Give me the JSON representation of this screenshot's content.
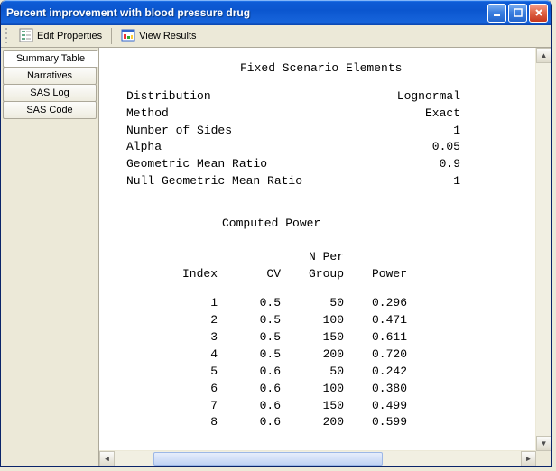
{
  "window": {
    "title": "Percent improvement with blood pressure drug"
  },
  "toolbar": {
    "edit_properties": "Edit Properties",
    "view_results": "View Results"
  },
  "sidebar": {
    "items": [
      {
        "label": "Summary Table",
        "active": true
      },
      {
        "label": "Narratives",
        "active": false
      },
      {
        "label": "SAS Log",
        "active": false
      },
      {
        "label": "SAS Code",
        "active": false
      }
    ]
  },
  "report": {
    "section1_title": "Fixed Scenario Elements",
    "params": [
      {
        "k": "Distribution",
        "v": "Lognormal"
      },
      {
        "k": "Method",
        "v": "Exact"
      },
      {
        "k": "Number of Sides",
        "v": "1"
      },
      {
        "k": "Alpha",
        "v": "0.05"
      },
      {
        "k": "Geometric Mean Ratio",
        "v": "0.9"
      },
      {
        "k": "Null Geometric Mean Ratio",
        "v": "1"
      }
    ],
    "section2_title": "Computed Power",
    "headers": {
      "index": "Index",
      "cv": "CV",
      "n_top": "N Per",
      "n_bottom": "Group",
      "power": "Power"
    },
    "rows": [
      {
        "i": "1",
        "cv": "0.5",
        "n": "50",
        "p": "0.296"
      },
      {
        "i": "2",
        "cv": "0.5",
        "n": "100",
        "p": "0.471"
      },
      {
        "i": "3",
        "cv": "0.5",
        "n": "150",
        "p": "0.611"
      },
      {
        "i": "4",
        "cv": "0.5",
        "n": "200",
        "p": "0.720"
      },
      {
        "i": "5",
        "cv": "0.6",
        "n": "50",
        "p": "0.242"
      },
      {
        "i": "6",
        "cv": "0.6",
        "n": "100",
        "p": "0.380"
      },
      {
        "i": "7",
        "cv": "0.6",
        "n": "150",
        "p": "0.499"
      },
      {
        "i": "8",
        "cv": "0.6",
        "n": "200",
        "p": "0.599"
      }
    ]
  },
  "chart_data": {
    "type": "table",
    "title": "Computed Power",
    "columns": [
      "Index",
      "CV",
      "N Per Group",
      "Power"
    ],
    "rows": [
      [
        1,
        0.5,
        50,
        0.296
      ],
      [
        2,
        0.5,
        100,
        0.471
      ],
      [
        3,
        0.5,
        150,
        0.611
      ],
      [
        4,
        0.5,
        200,
        0.72
      ],
      [
        5,
        0.6,
        50,
        0.242
      ],
      [
        6,
        0.6,
        100,
        0.38
      ],
      [
        7,
        0.6,
        150,
        0.499
      ],
      [
        8,
        0.6,
        200,
        0.599
      ]
    ],
    "fixed_scenario": {
      "Distribution": "Lognormal",
      "Method": "Exact",
      "Number of Sides": 1,
      "Alpha": 0.05,
      "Geometric Mean Ratio": 0.9,
      "Null Geometric Mean Ratio": 1
    }
  }
}
